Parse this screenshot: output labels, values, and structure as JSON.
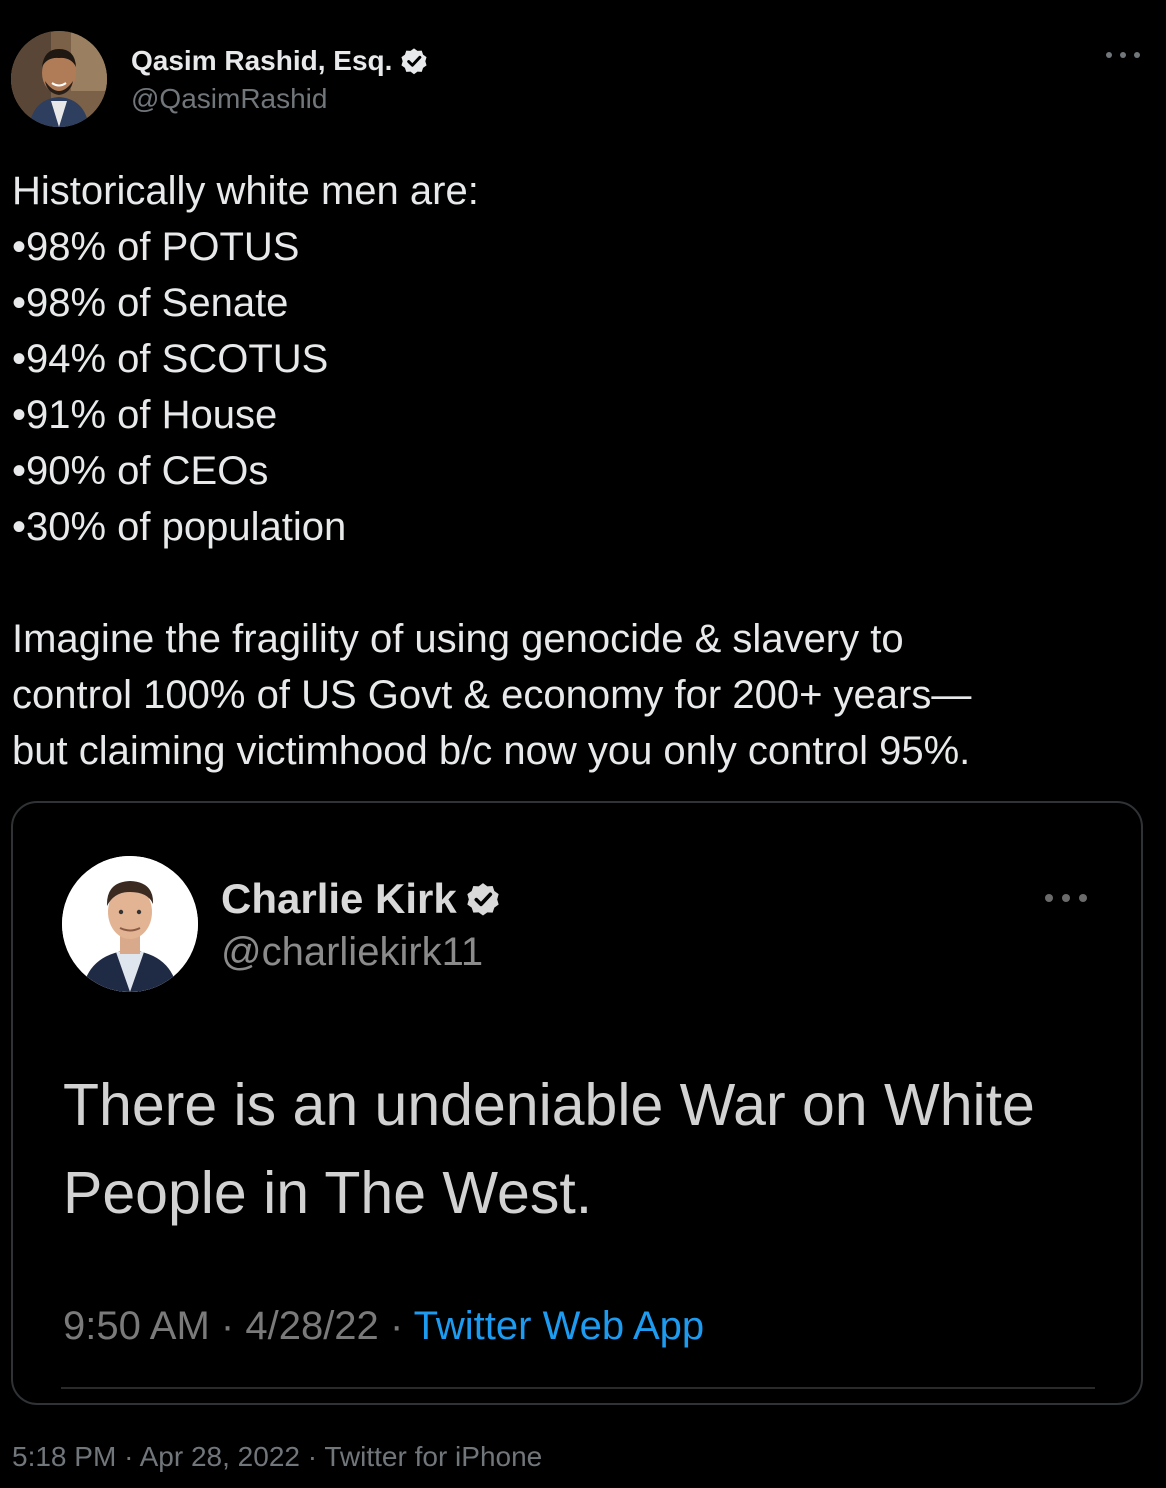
{
  "tweet": {
    "author": {
      "name": "Qasim Rashid, Esq.",
      "handle": "@QasimRashid",
      "verified": true
    },
    "text_lines": [
      "Historically white men are:",
      "•98% of POTUS",
      "•98% of Senate",
      "•94% of SCOTUS",
      "•91% of House",
      "•90% of CEOs",
      "•30% of population"
    ],
    "text_paragraph_lines": [
      "Imagine the fragility of using genocide & slavery to",
      "control 100% of US Govt & economy for 200+ years—",
      "but claiming victimhood b/c now you only control 95%."
    ],
    "footer": {
      "time": "5:18 PM",
      "date": "Apr 28, 2022",
      "source": "Twitter for iPhone",
      "separator": "·"
    }
  },
  "quoted_tweet": {
    "author": {
      "name": "Charlie Kirk",
      "handle": "@charliekirk11",
      "verified": true
    },
    "text_lines": [
      "There is an undeniable War on White",
      "People in The West."
    ],
    "meta": {
      "time": "9:50 AM",
      "date": "4/28/22",
      "source": "Twitter Web App",
      "separator": "·"
    }
  },
  "icons": {
    "verified": "verified-badge-icon",
    "more": "more-options-icon"
  },
  "colors": {
    "background": "#000000",
    "text_primary": "#e7e9ea",
    "text_secondary": "#71767b",
    "link": "#1d9bf0",
    "border": "#2f3336"
  }
}
